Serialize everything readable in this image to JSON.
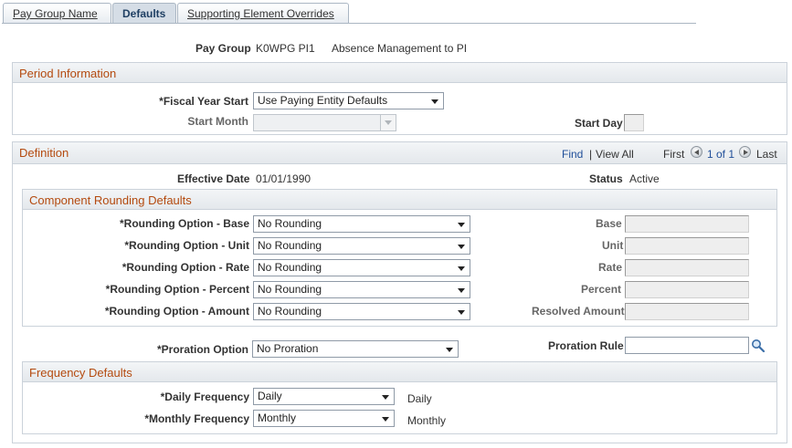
{
  "tabs": [
    {
      "label": "Pay Group Name",
      "active": false
    },
    {
      "label": "Defaults",
      "active": true
    },
    {
      "label": "Supporting Element Overrides",
      "active": false
    }
  ],
  "header": {
    "pay_group_label": "Pay Group",
    "pay_group_code": "K0WPG PI1",
    "pay_group_desc": "Absence Management to PI"
  },
  "period": {
    "title": "Period Information",
    "fiscal_year_start_label": "*Fiscal Year Start",
    "fiscal_year_start_value": "Use Paying Entity Defaults",
    "start_month_label": "Start Month",
    "start_month_value": "",
    "start_day_label": "Start Day",
    "start_day_value": ""
  },
  "definition": {
    "title": "Definition",
    "nav": {
      "find": "Find",
      "sep": "|",
      "view_all": "View All",
      "first": "First",
      "range": "1 of 1",
      "last": "Last"
    },
    "effective_date_label": "Effective Date",
    "effective_date_value": "01/01/1990",
    "status_label": "Status",
    "status_value": "Active"
  },
  "rounding": {
    "title": "Component Rounding Defaults",
    "rows": [
      {
        "label": "*Rounding Option - Base",
        "value": "No Rounding",
        "right_label": "Base",
        "right_value": ""
      },
      {
        "label": "*Rounding Option - Unit",
        "value": "No Rounding",
        "right_label": "Unit",
        "right_value": ""
      },
      {
        "label": "*Rounding Option - Rate",
        "value": "No Rounding",
        "right_label": "Rate",
        "right_value": ""
      },
      {
        "label": "*Rounding Option - Percent",
        "value": "No Rounding",
        "right_label": "Percent",
        "right_value": ""
      },
      {
        "label": "*Rounding Option - Amount",
        "value": "No Rounding",
        "right_label": "Resolved Amount",
        "right_value": ""
      }
    ]
  },
  "proration": {
    "option_label": "*Proration Option",
    "option_value": "No Proration",
    "rule_label": "Proration Rule",
    "rule_value": ""
  },
  "frequency": {
    "title": "Frequency Defaults",
    "daily_label": "*Daily Frequency",
    "daily_value": "Daily",
    "daily_desc": "Daily",
    "monthly_label": "*Monthly Frequency",
    "monthly_value": "Monthly",
    "monthly_desc": "Monthly"
  },
  "colors": {
    "section_title": "#b44a0f",
    "link": "#1f4e99",
    "border": "#cbd2da"
  }
}
